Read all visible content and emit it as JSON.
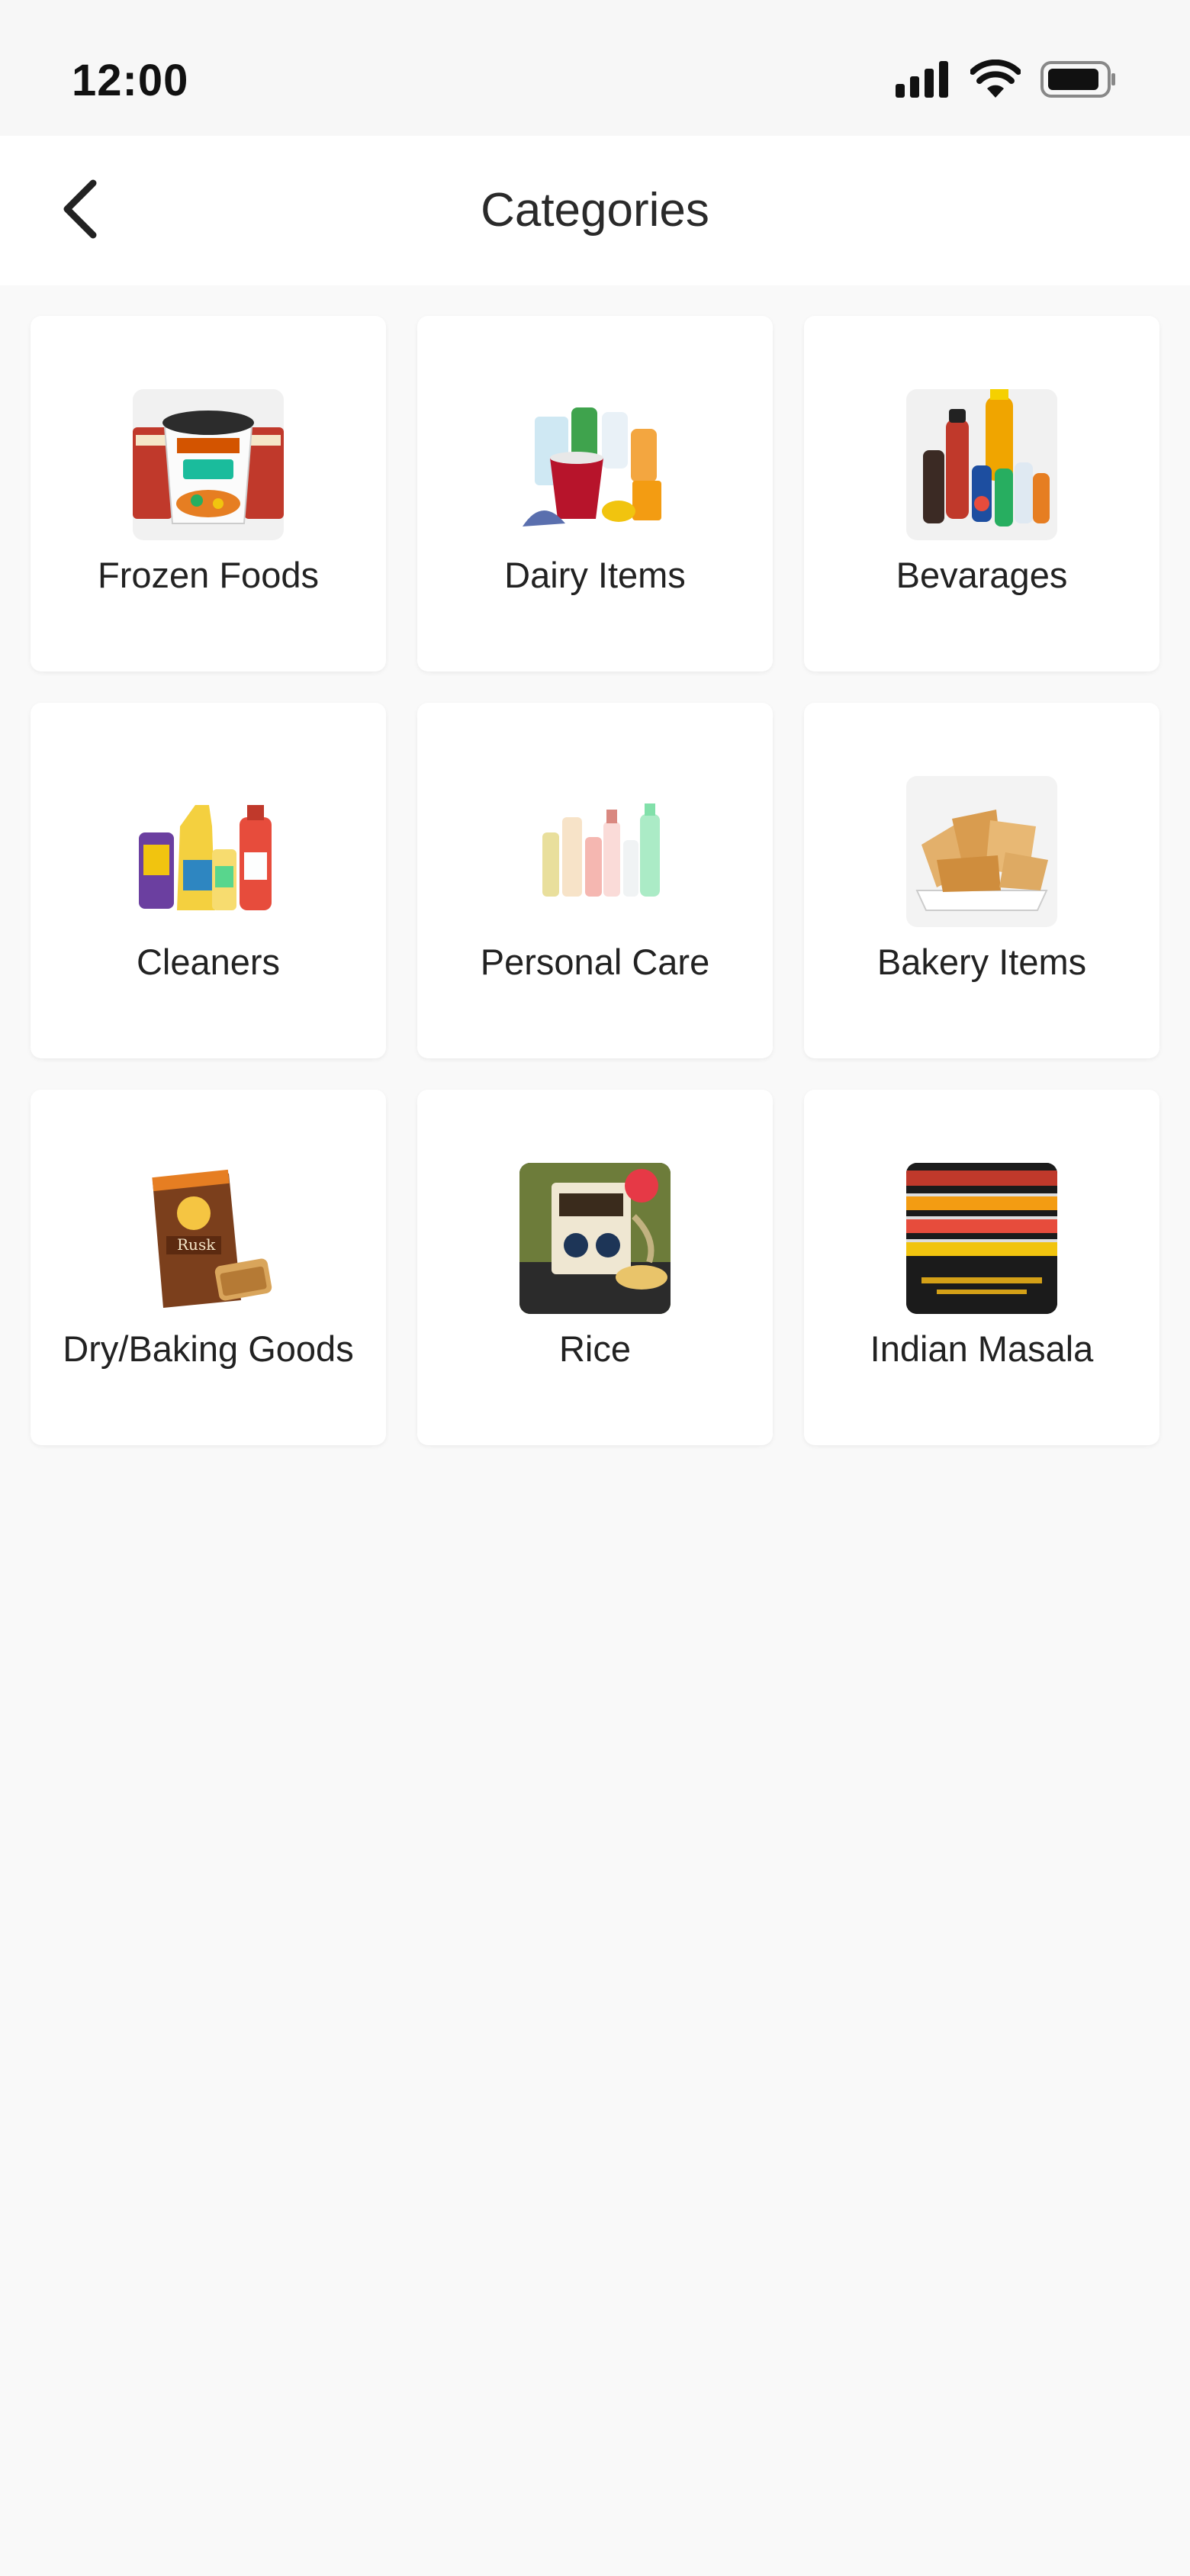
{
  "status_bar": {
    "time": "12:00",
    "icons": [
      "signal-icon",
      "wifi-icon",
      "battery-icon"
    ]
  },
  "header": {
    "title": "Categories",
    "back_icon": "chevron-left-icon"
  },
  "categories": [
    {
      "label": "Frozen Foods",
      "image": "frozen-foods-image"
    },
    {
      "label": "Dairy Items",
      "image": "dairy-items-image"
    },
    {
      "label": "Bevarages",
      "image": "beverages-image"
    },
    {
      "label": "Cleaners",
      "image": "cleaners-image"
    },
    {
      "label": "Personal Care",
      "image": "personal-care-image"
    },
    {
      "label": "Bakery Items",
      "image": "bakery-items-image"
    },
    {
      "label": "Dry/Baking Goods",
      "image": "dry-baking-goods-image"
    },
    {
      "label": "Rice",
      "image": "rice-image"
    },
    {
      "label": "Indian Masala",
      "image": "indian-masala-image"
    }
  ],
  "colors": {
    "background": "#f9f9f9",
    "card": "#ffffff",
    "text": "#222222"
  }
}
